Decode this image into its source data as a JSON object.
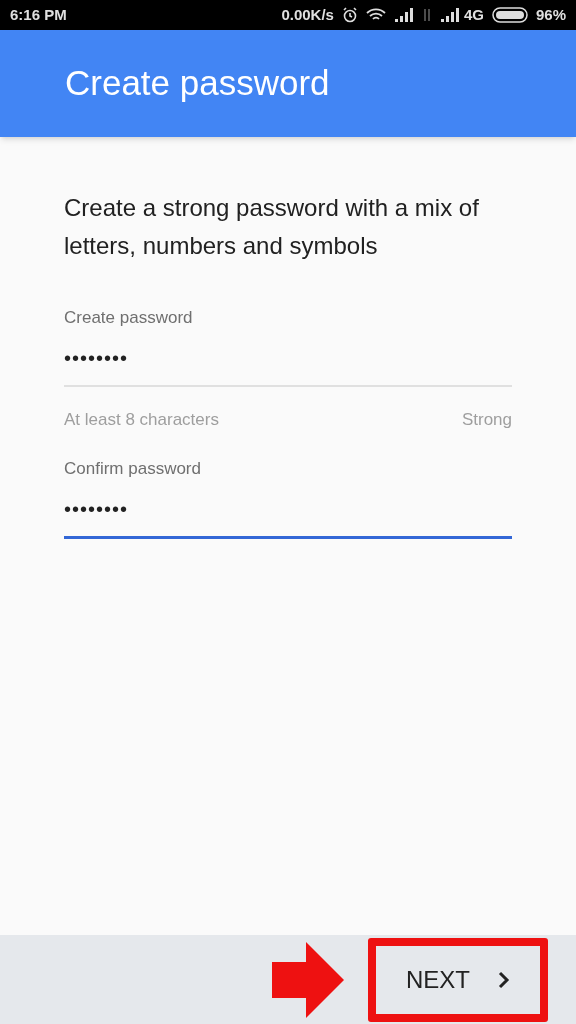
{
  "status_bar": {
    "time": "6:16 PM",
    "net_speed": "0.00K/s",
    "network": "4G",
    "battery": "96%"
  },
  "app_bar": {
    "title": "Create password"
  },
  "intro": "Create a strong password with a mix of letters, numbers and symbols",
  "fields": [
    {
      "label": "Create password",
      "value": "••••••••",
      "focused": false,
      "helper": "At least 8 characters",
      "strength": "Strong"
    },
    {
      "label": "Confirm password",
      "value": "••••••••",
      "focused": true
    }
  ],
  "footer": {
    "next_button": "NEXT",
    "annotation_highlight": true
  }
}
